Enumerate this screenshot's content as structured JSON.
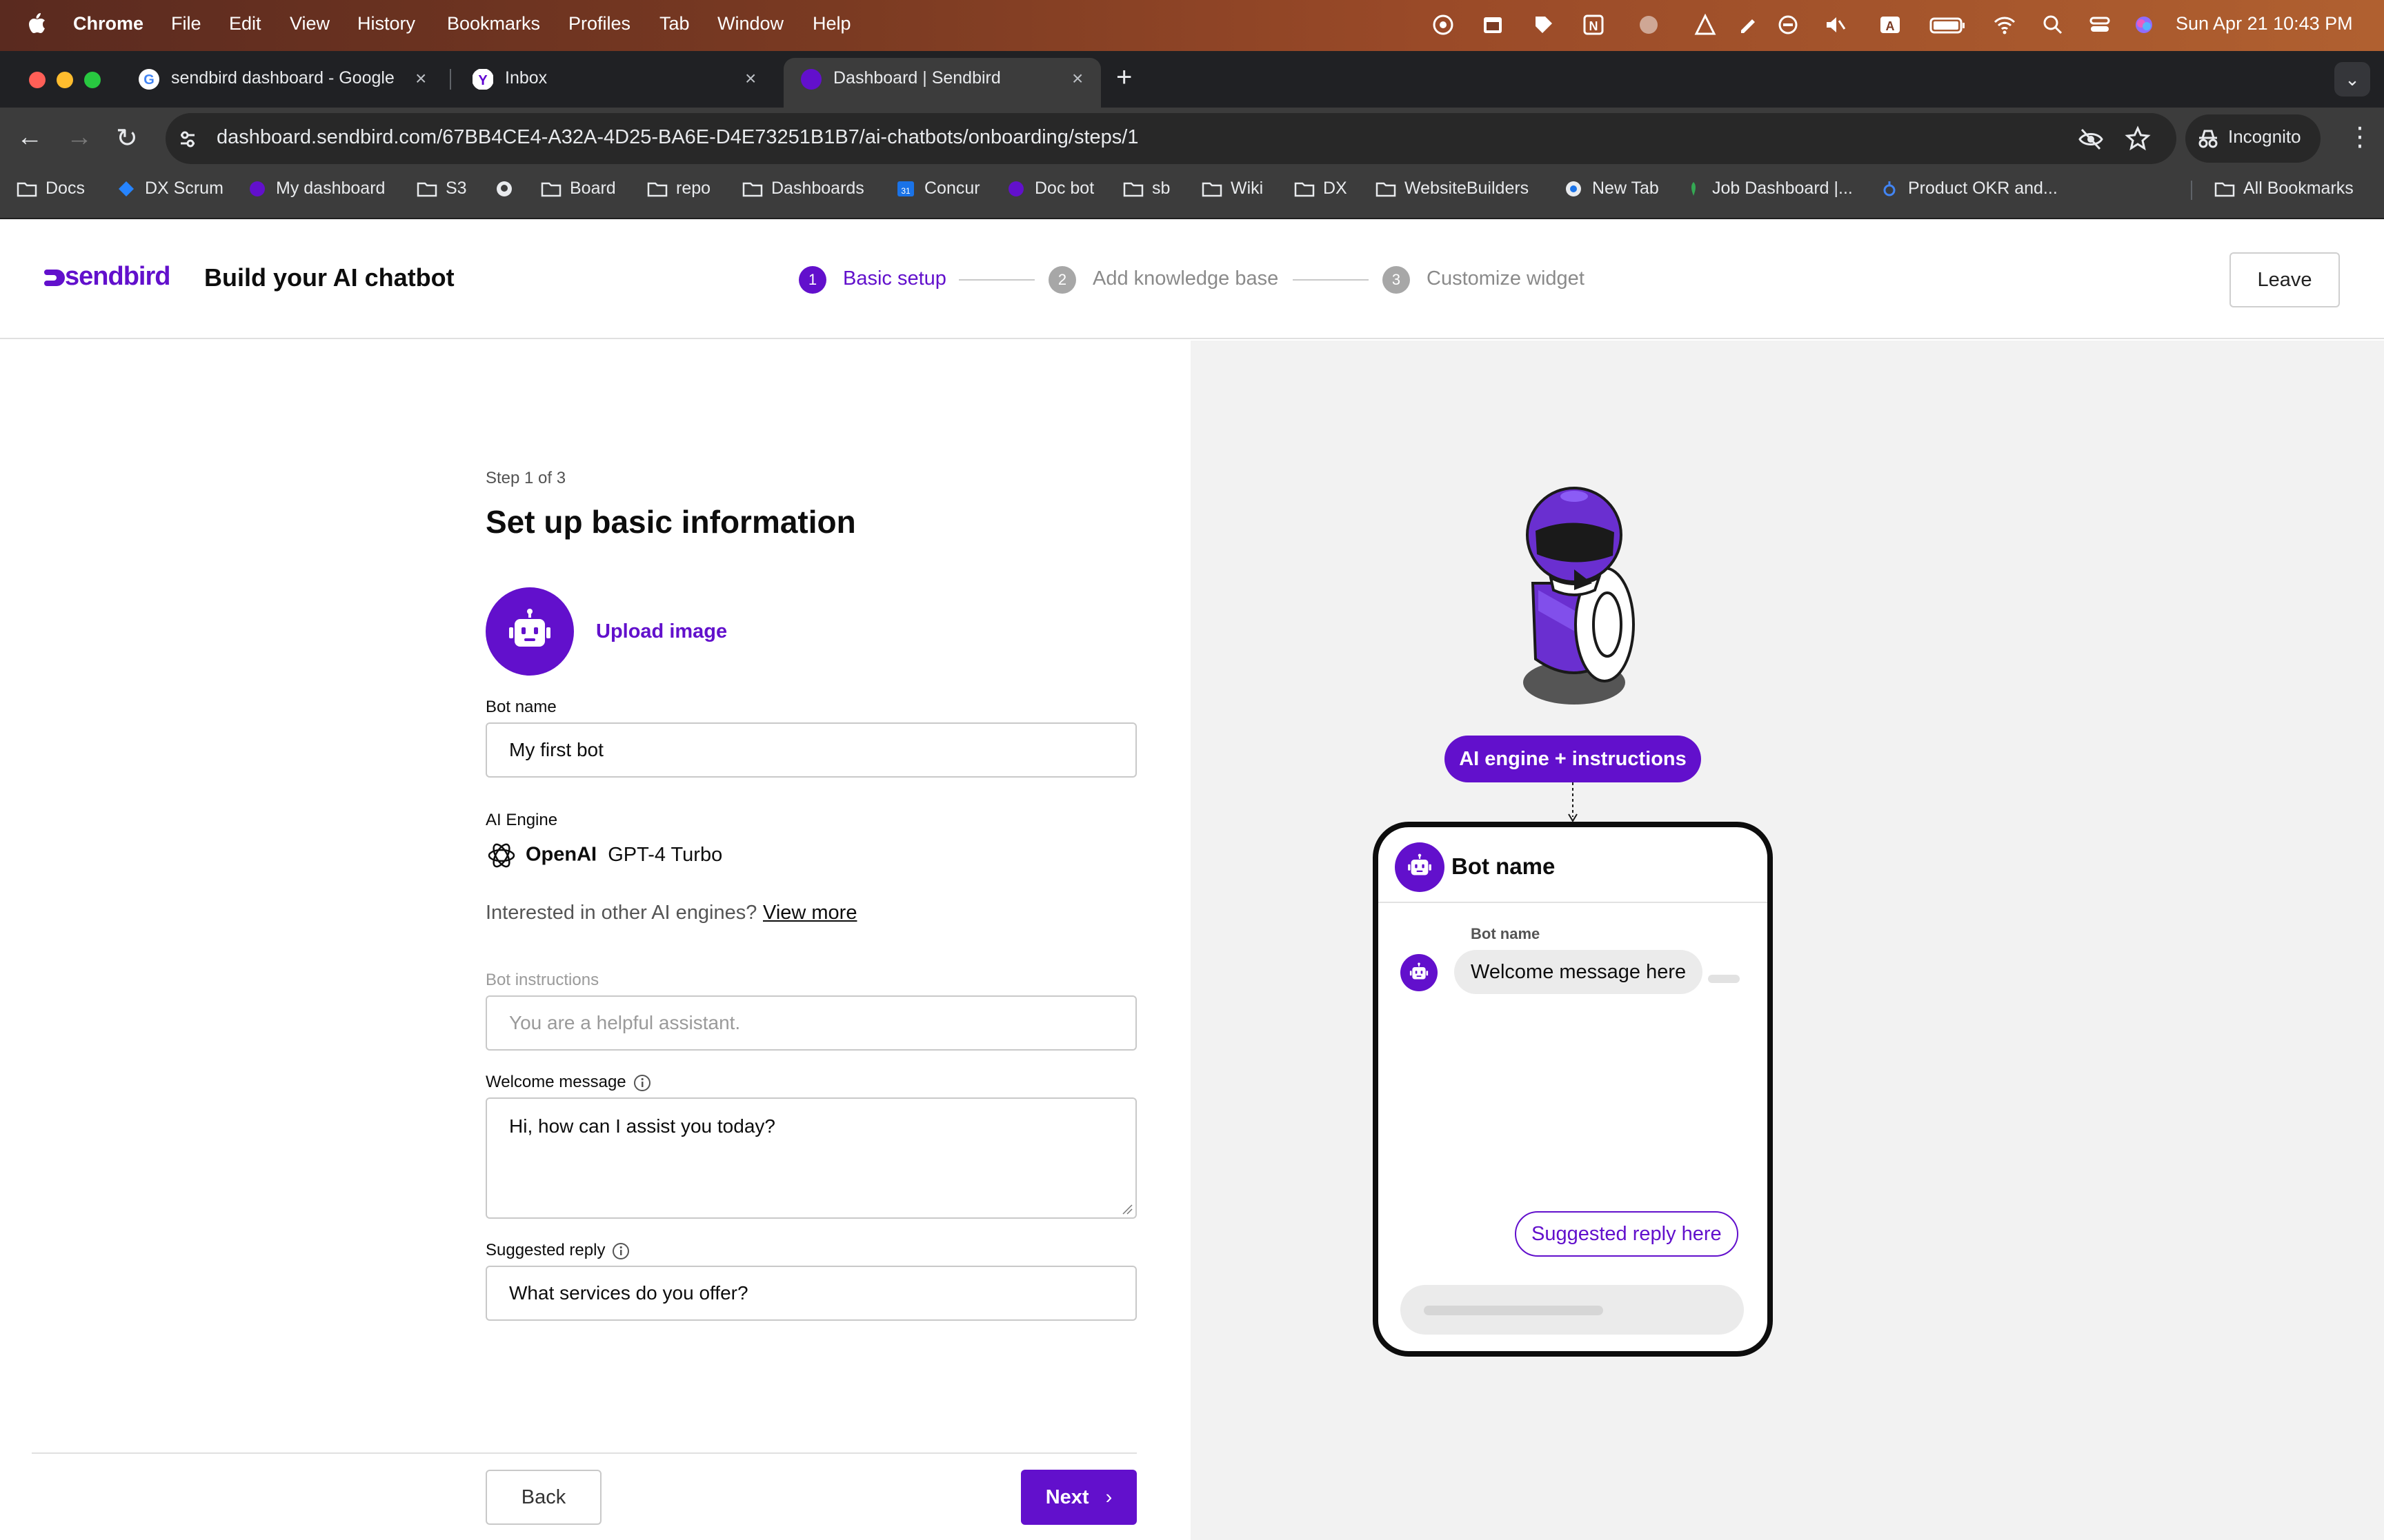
{
  "menubar": {
    "app": "Chrome",
    "items": [
      "File",
      "Edit",
      "View",
      "History",
      "Bookmarks",
      "Profiles",
      "Tab",
      "Window",
      "Help"
    ],
    "clock": "Sun Apr 21  10:43 PM"
  },
  "tabs": [
    {
      "title": "sendbird dashboard - Google",
      "icon": "google-icon"
    },
    {
      "title": "Inbox",
      "icon": "yahoo-mail-icon"
    },
    {
      "title": "Dashboard | Sendbird",
      "icon": "sendbird-icon",
      "active": true
    }
  ],
  "address": {
    "url": "dashboard.sendbird.com/67BB4CE4-A32A-4D25-BA6E-D4E73251B1B7/ai-chatbots/onboarding/steps/1",
    "incognito_label": "Incognito"
  },
  "bookmarks": [
    "Docs",
    "DX Scrum",
    "My dashboard",
    "S3",
    "",
    "Board",
    "repo",
    "Dashboards",
    "Concur",
    "Doc bot",
    "sb",
    "Wiki",
    "DX",
    "WebsiteBuilders",
    "New Tab",
    "Job Dashboard |...",
    "Product OKR and..."
  ],
  "all_bookmarks": "All Bookmarks",
  "header": {
    "logo": "sendbird",
    "title": "Build your AI chatbot",
    "steps": [
      {
        "num": "1",
        "label": "Basic setup"
      },
      {
        "num": "2",
        "label": "Add knowledge base"
      },
      {
        "num": "3",
        "label": "Customize widget"
      }
    ],
    "leave": "Leave"
  },
  "form": {
    "step_count": "Step 1 of 3",
    "title": "Set up basic information",
    "upload": "Upload image",
    "bot_name_label": "Bot name",
    "bot_name_value": "My first bot",
    "engine_label": "AI Engine",
    "engine_vendor": "OpenAI",
    "engine_model": "GPT-4 Turbo",
    "interest_text": "Interested in other AI engines?",
    "view_more": "View more",
    "instructions_label": "Bot instructions",
    "instructions_placeholder": "You are a helpful assistant.",
    "welcome_label": "Welcome message",
    "welcome_value": "Hi, how can I assist you today?",
    "suggested_label": "Suggested reply",
    "suggested_value": "What services do you offer?",
    "back": "Back",
    "next": "Next"
  },
  "preview": {
    "engine_pill": "AI engine + instructions",
    "bot_name": "Bot name",
    "sender_label": "Bot name",
    "welcome": "Welcome message here",
    "suggested": "Suggested reply here"
  },
  "colors": {
    "brand": "#6210cc",
    "preview_bg": "#f2f2f2"
  }
}
